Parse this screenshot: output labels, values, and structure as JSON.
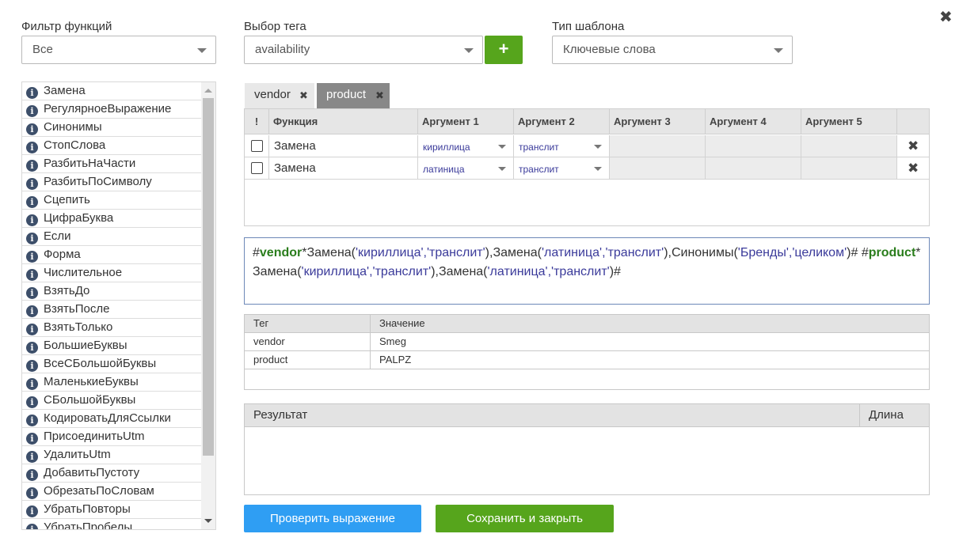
{
  "filters": {
    "function_filter_label": "Фильтр функций",
    "function_filter_value": "Все",
    "tag_select_label": "Выбор тега",
    "tag_select_value": "availability",
    "template_type_label": "Тип шаблона",
    "template_type_value": "Ключевые слова",
    "add_tag_icon": "+"
  },
  "close_icon": "✖",
  "function_list": [
    "Замена",
    "РегулярноеВыражение",
    "Синонимы",
    "СтопСлова",
    "РазбитьНаЧасти",
    "РазбитьПоСимволу",
    "Сцепить",
    "ЦифраБуква",
    "Если",
    "Форма",
    "Числительное",
    "ВзятьДо",
    "ВзятьПосле",
    "ВзятьТолько",
    "БольшиеБуквы",
    "ВсеСБольшойБуквы",
    "МаленькиеБуквы",
    "СБольшойБуквы",
    "КодироватьДляСсылки",
    "ПрисоединитьUtm",
    "УдалитьUtm",
    "ДобавитьПустоту",
    "ОбрезатьПоСловам",
    "УбратьПовторы",
    "УбратьПробелы"
  ],
  "info_icon_glyph": "i",
  "tabs": [
    {
      "label": "vendor",
      "active": false
    },
    {
      "label": "product",
      "active": true
    }
  ],
  "grid": {
    "headers": [
      "!",
      "Функция",
      "Аргумент 1",
      "Аргумент 2",
      "Аргумент 3",
      "Аргумент 4",
      "Аргумент 5",
      ""
    ],
    "rows": [
      {
        "function": "Замена",
        "arg1": "кириллица",
        "arg2": "транслит"
      },
      {
        "function": "Замена",
        "arg1": "латиница",
        "arg2": "транслит"
      }
    ]
  },
  "expression": {
    "parts": [
      {
        "t": "#",
        "c": "plain"
      },
      {
        "t": "vendor",
        "c": "tag"
      },
      {
        "t": "*Замена(",
        "c": "plain"
      },
      {
        "t": "'кириллица','транслит'",
        "c": "arg"
      },
      {
        "t": "),Замена(",
        "c": "plain"
      },
      {
        "t": "'латиница','транслит'",
        "c": "arg"
      },
      {
        "t": "),Синонимы(",
        "c": "plain"
      },
      {
        "t": "'Бренды','целиком'",
        "c": "arg"
      },
      {
        "t": ")# #",
        "c": "plain"
      },
      {
        "t": "product",
        "c": "tag"
      },
      {
        "t": "*Замена(",
        "c": "plain"
      },
      {
        "t": "'кириллица','транслит'",
        "c": "arg"
      },
      {
        "t": "),Замена(",
        "c": "plain"
      },
      {
        "t": "'латиница','транслит'",
        "c": "arg"
      },
      {
        "t": ")#",
        "c": "plain"
      }
    ]
  },
  "tag_table": {
    "headers": [
      "Тег",
      "Значение"
    ],
    "rows": [
      {
        "tag": "vendor",
        "value": "Smeg"
      },
      {
        "tag": "product",
        "value": "PALPZ"
      }
    ]
  },
  "result_table": {
    "headers": [
      "Результат",
      "Длина"
    ]
  },
  "buttons": {
    "check": "Проверить выражение",
    "save": "Сохранить и закрыть"
  },
  "colors": {
    "check_button": "#2f9ef3",
    "save_button": "#56a51c",
    "add_button": "#56a51c",
    "active_tab": "#888888",
    "tag_name": "#2a7d1c",
    "arg_text": "#3a3a9a"
  }
}
